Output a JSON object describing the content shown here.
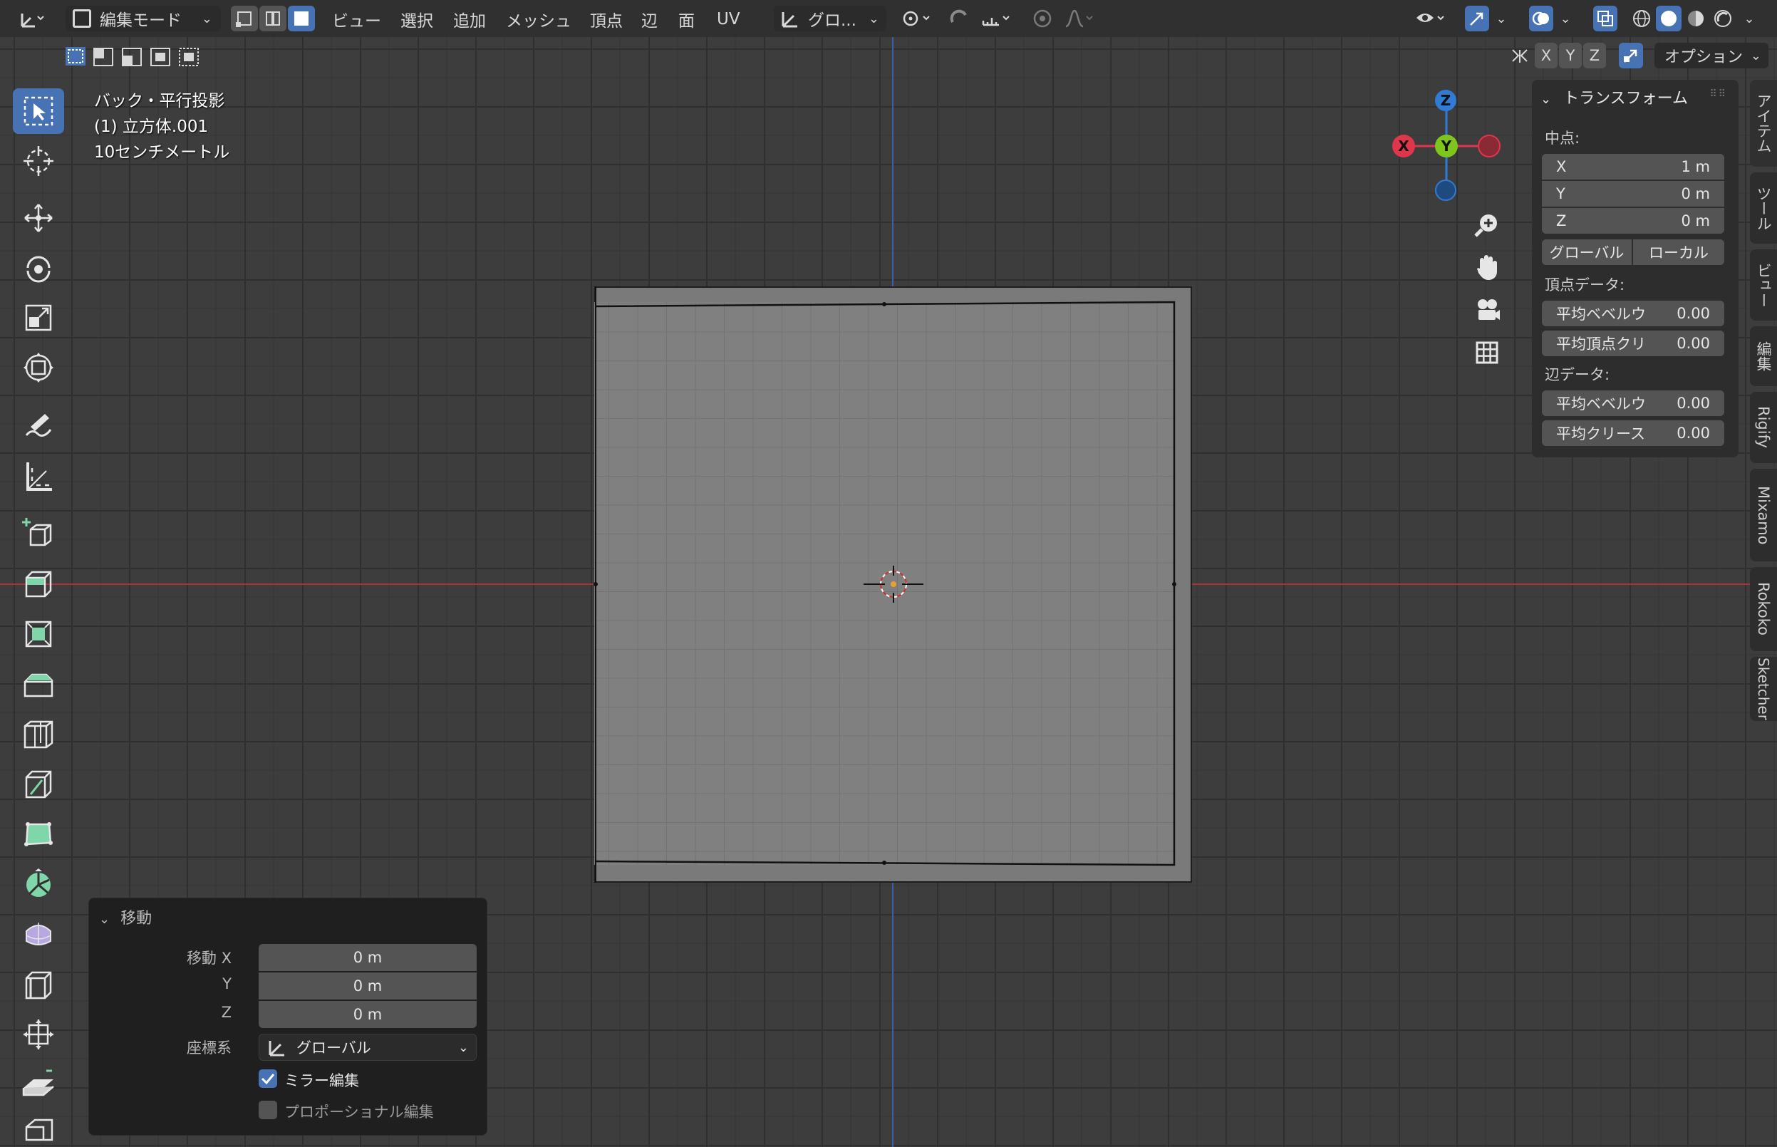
{
  "header": {
    "mode_label": "編集モード",
    "menus": [
      "ビュー",
      "選択",
      "追加",
      "メッシュ",
      "頂点",
      "辺",
      "面",
      "UV"
    ],
    "transform_orientation": "グロ...",
    "axis_labels": [
      "X",
      "Y",
      "Z"
    ],
    "options_label": "オプション"
  },
  "viewport": {
    "view_name": "バック・平行投影",
    "object_name": "(1) 立方体.001",
    "scale_label": "10センチメートル"
  },
  "gizmo": {
    "x": "X",
    "y": "Y",
    "z": "Z"
  },
  "npanel": {
    "title": "トランスフォーム",
    "median_label": "中点:",
    "median": [
      {
        "axis": "X",
        "value": "1 m"
      },
      {
        "axis": "Y",
        "value": "0 m"
      },
      {
        "axis": "Z",
        "value": "0 m"
      }
    ],
    "global_label": "グローバル",
    "local_label": "ローカル",
    "vertex_data_label": "頂点データ:",
    "vertex_fields": [
      {
        "label": "平均ベベルウ",
        "value": "0.00"
      },
      {
        "label": "平均頂点クリ",
        "value": "0.00"
      }
    ],
    "edge_data_label": "辺データ:",
    "edge_fields": [
      {
        "label": "平均ベベルウ",
        "value": "0.00"
      },
      {
        "label": "平均クリース",
        "value": "0.00"
      }
    ]
  },
  "side_tabs": [
    "アイテム",
    "ツール",
    "ビュー",
    "編集",
    "Rigify",
    "Mixamo",
    "Rokoko",
    "Sketcher"
  ],
  "operator_panel": {
    "title": "移動",
    "move_x_label": "移動 X",
    "move_y_label": "Y",
    "move_z_label": "Z",
    "move_x": "0 m",
    "move_y": "0 m",
    "move_z": "0 m",
    "orientation_label": "座標系",
    "orientation_value": "グローバル",
    "mirror_label": "ミラー編集",
    "mirror_checked": true,
    "proportional_label": "プロポーショナル編集",
    "proportional_checked": false
  },
  "colors": {
    "accent": "#4772b3",
    "x_axis": "#e0364b",
    "y_axis": "#7ec61d",
    "z_axis": "#2f7bd6"
  }
}
